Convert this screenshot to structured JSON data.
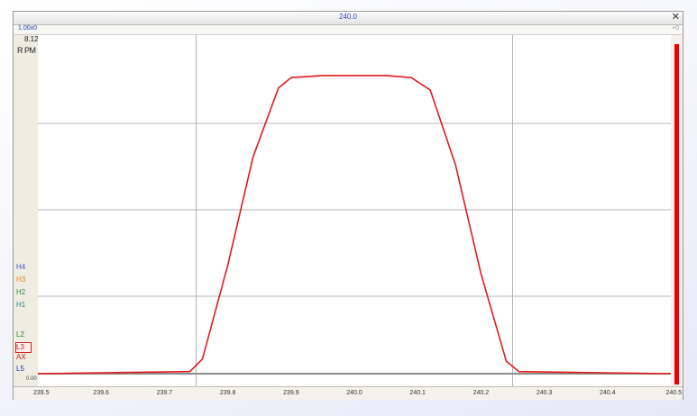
{
  "window": {
    "title": "240.0"
  },
  "toolbar": {
    "zoom_label": "1.00x0",
    "right_marker": "+0"
  },
  "colors": {
    "trace": "#e31b1b",
    "baseline": "#8c8c8c",
    "grid": "#b4b4b4",
    "scroll_bar": "#ee0000",
    "title_text": "#2f46c8"
  },
  "icons": {
    "close": "close-icon"
  },
  "y_axis": {
    "label": "R PM",
    "max_label": "8.12",
    "min_label": "0.00"
  },
  "markers": [
    {
      "label": "H4",
      "color": "#4455cc"
    },
    {
      "label": "H3",
      "color": "#e08a1e"
    },
    {
      "label": "H2",
      "color": "#2f8a4a"
    },
    {
      "label": "H1",
      "color": "#2a8a8a"
    },
    {
      "label": "L2",
      "color": "#2a8a2a"
    },
    {
      "label": "L3",
      "color": "#cc2222"
    },
    {
      "label": "AX",
      "color": "#cc2222"
    },
    {
      "label": "L5",
      "color": "#2233aa"
    }
  ],
  "chart_data": {
    "type": "line",
    "title": "240.0",
    "xlabel": "",
    "ylabel": "R PM",
    "xlim": [
      239.5,
      240.5
    ],
    "ylim": [
      0,
      8.12
    ],
    "x_ticks": [
      "239.5",
      "239.6",
      "239.7",
      "239.8",
      "239.9",
      "240.0",
      "240.1",
      "240.2",
      "240.3",
      "240.4",
      "240.5"
    ],
    "grid": true,
    "series": [
      {
        "color": "#e31b1b",
        "x": [
          239.5,
          239.74,
          239.76,
          239.8,
          239.84,
          239.88,
          239.9,
          239.95,
          240.0,
          240.05,
          240.09,
          240.12,
          240.16,
          240.2,
          240.24,
          240.26,
          240.5
        ],
        "y": [
          0.0,
          0.05,
          0.35,
          2.6,
          5.2,
          6.85,
          7.1,
          7.15,
          7.15,
          7.15,
          7.1,
          6.8,
          5.0,
          2.4,
          0.3,
          0.05,
          0.0
        ]
      }
    ],
    "baseline": 0.0
  }
}
